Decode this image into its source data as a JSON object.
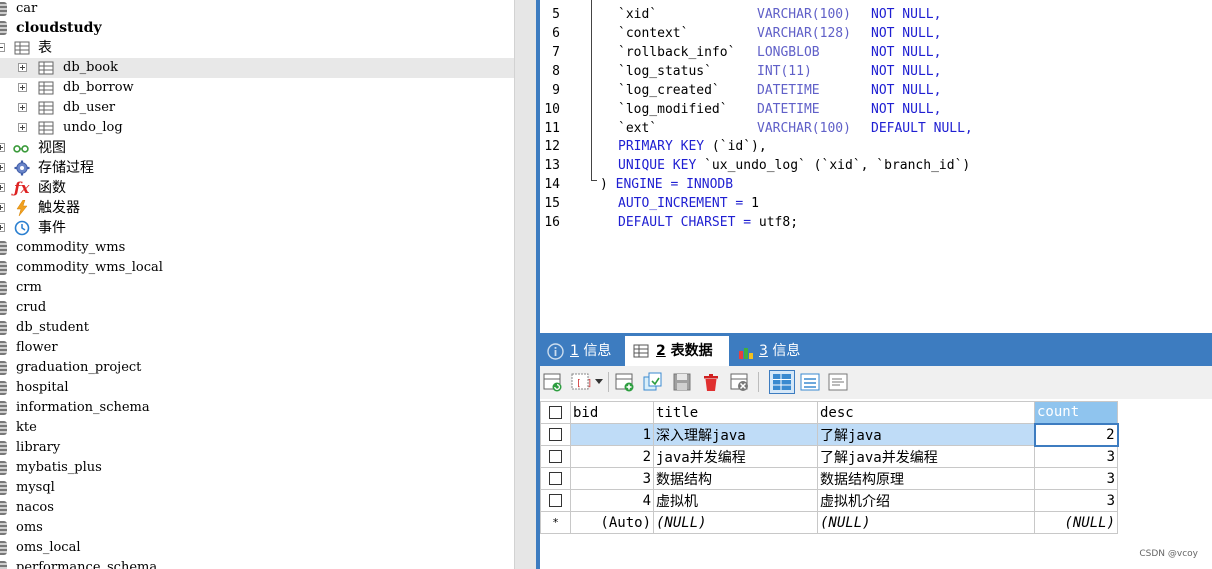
{
  "tree": {
    "top_db": "car",
    "current_db": "cloudstudy",
    "tables_group": "表",
    "tables": [
      "db_book",
      "db_borrow",
      "db_user",
      "undo_log"
    ],
    "selected_table": "db_book",
    "groups": [
      "视图",
      "存储过程",
      "函数",
      "触发器",
      "事件"
    ],
    "databases": [
      "commodity_wms",
      "commodity_wms_local",
      "crm",
      "crud",
      "db_student",
      "flower",
      "graduation_project",
      "hospital",
      "information_schema",
      "kte",
      "library",
      "mybatis_plus",
      "mysql",
      "nacos",
      "oms",
      "oms_local",
      "performance_schema"
    ]
  },
  "editor": {
    "line_numbers": [
      "5",
      "6",
      "7",
      "8",
      "9",
      "10",
      "11",
      "12",
      "13",
      "14",
      "15",
      "16"
    ],
    "l5": {
      "col": "`xid`",
      "type": "VARCHAR(100)",
      "nn": "NOT NULL,"
    },
    "l6": {
      "col": "`context`",
      "type": "VARCHAR(128)",
      "nn": "NOT NULL,"
    },
    "l7": {
      "col": "`rollback_info`",
      "type": "LONGBLOB",
      "nn": "NOT NULL,"
    },
    "l8": {
      "col": "`log_status`",
      "type": "INT(11)",
      "nn": "NOT NULL,"
    },
    "l9": {
      "col": "`log_created`",
      "type": "DATETIME",
      "nn": "NOT NULL,"
    },
    "l10": {
      "col": "`log_modified`",
      "type": "DATETIME",
      "nn": "NOT NULL,"
    },
    "l11": {
      "col": "`ext`",
      "type": "VARCHAR(100)",
      "nn": "DEFAULT NULL,"
    },
    "l12": {
      "kw": "PRIMARY KEY",
      "rest": "(`id`),"
    },
    "l13": {
      "kw": "UNIQUE KEY",
      "rest": "`ux_undo_log` (`xid`, `branch_id`)"
    },
    "l14": {
      "paren": ")",
      "kw": "ENGINE",
      "eq": "=",
      "val": "INNODB"
    },
    "l15": {
      "kw": "AUTO_INCREMENT",
      "eq": "=",
      "val": "1"
    },
    "l16": {
      "kw": "DEFAULT CHARSET",
      "eq": "=",
      "val": "utf8;"
    }
  },
  "tabs": [
    {
      "num": "1",
      "label": "信息"
    },
    {
      "num": "2",
      "label": "表数据"
    },
    {
      "num": "3",
      "label": "信息"
    }
  ],
  "grid": {
    "columns": [
      "bid",
      "title",
      "desc",
      "count"
    ],
    "rows": [
      {
        "bid": "1",
        "title": "深入理解java",
        "desc": "了解java",
        "count": "2"
      },
      {
        "bid": "2",
        "title": "java并发编程",
        "desc": "了解java并发编程",
        "count": "3"
      },
      {
        "bid": "3",
        "title": "数据结构",
        "desc": "数据结构原理",
        "count": "3"
      },
      {
        "bid": "4",
        "title": "虚拟机",
        "desc": "虚拟机介绍",
        "count": "3"
      }
    ],
    "new_row": {
      "marker": "*",
      "bid": "(Auto)",
      "title": "(NULL)",
      "desc": "(NULL)",
      "count": "(NULL)"
    }
  },
  "watermark": "CSDN @vcoy",
  "colors": {
    "accent": "#3d7cc0",
    "keyword": "#1f1fd2",
    "selected_row": "#bfdcf7",
    "header_active": "#8fc4ee"
  }
}
